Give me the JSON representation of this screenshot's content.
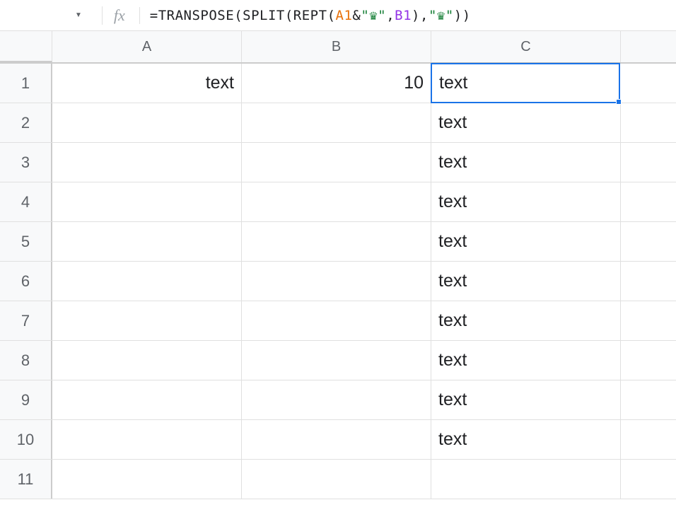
{
  "formula_bar": {
    "fx_label": "fx",
    "formula_parts": {
      "p1": "=TRANSPOSE",
      "p2": "(",
      "p3": "SPLIT",
      "p4": "(",
      "p5": "REPT",
      "p6": "(",
      "ref_a1": "A1",
      "amp": "&",
      "str1": "\"♛\"",
      "comma1": ",",
      "ref_b1": "B1",
      "p7": ")",
      "comma2": ",",
      "str2": "\"♛\"",
      "p8": "))"
    }
  },
  "columns": [
    "A",
    "B",
    "C"
  ],
  "rows": [
    "1",
    "2",
    "3",
    "4",
    "5",
    "6",
    "7",
    "8",
    "9",
    "10",
    "11"
  ],
  "cells": {
    "A1": "text",
    "B1": "10",
    "C1": "text",
    "C2": "text",
    "C3": "text",
    "C4": "text",
    "C5": "text",
    "C6": "text",
    "C7": "text",
    "C8": "text",
    "C9": "text",
    "C10": "text"
  },
  "selected_cell": "C1"
}
